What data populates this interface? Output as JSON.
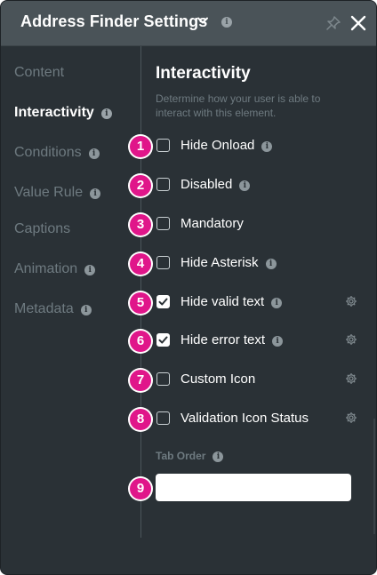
{
  "header": {
    "title": "Address Finder Settings",
    "info": "i"
  },
  "nav": {
    "items": [
      {
        "label": "Content",
        "active": false,
        "info": false
      },
      {
        "label": "Interactivity",
        "active": true,
        "info": true
      },
      {
        "label": "Conditions",
        "active": false,
        "info": true
      },
      {
        "label": "Value Rule",
        "active": false,
        "info": true
      },
      {
        "label": "Captions",
        "active": false,
        "info": false
      },
      {
        "label": "Animation",
        "active": false,
        "info": true
      },
      {
        "label": "Metadata",
        "active": false,
        "info": true
      }
    ],
    "info_glyph": "i"
  },
  "section": {
    "title": "Interactivity",
    "description": "Determine how your user is able to interact with this element."
  },
  "options": [
    {
      "badge": "1",
      "label": "Hide Onload",
      "checked": false,
      "info": true,
      "gear": false
    },
    {
      "badge": "2",
      "label": "Disabled",
      "checked": false,
      "info": true,
      "gear": false
    },
    {
      "badge": "3",
      "label": "Mandatory",
      "checked": false,
      "info": false,
      "gear": false
    },
    {
      "badge": "4",
      "label": "Hide Asterisk",
      "checked": false,
      "info": true,
      "gear": false
    },
    {
      "badge": "5",
      "label": "Hide valid text",
      "checked": true,
      "info": true,
      "gear": true
    },
    {
      "badge": "6",
      "label": "Hide error text",
      "checked": true,
      "info": true,
      "gear": true
    },
    {
      "badge": "7",
      "label": "Custom Icon",
      "checked": false,
      "info": false,
      "gear": true
    },
    {
      "badge": "8",
      "label": "Validation Icon Status",
      "checked": false,
      "info": false,
      "gear": true
    }
  ],
  "tab_order": {
    "label": "Tab Order",
    "info": "i",
    "badge": "9",
    "value": "",
    "placeholder": ""
  },
  "colors": {
    "panel_bg": "#2a3136",
    "header_bg": "#4a5358",
    "badge_pink": "#e0168a",
    "muted_text": "#6e7a80"
  },
  "icons": [
    "chevron-down-icon",
    "info-icon",
    "pin-icon",
    "close-icon",
    "gear-icon",
    "checkmark-icon"
  ]
}
